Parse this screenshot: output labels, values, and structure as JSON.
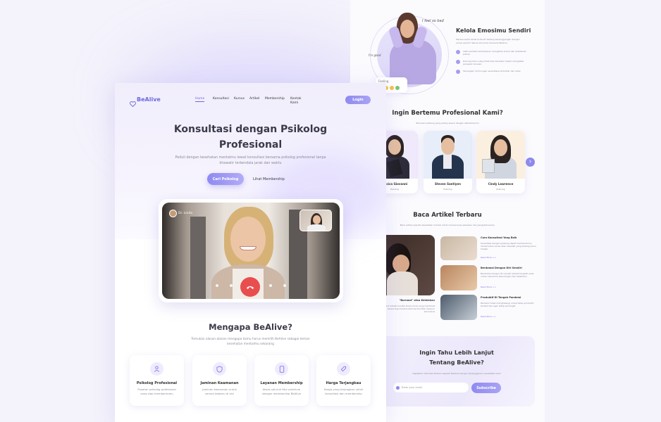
{
  "brand": {
    "name": "BeAlive"
  },
  "nav": {
    "items": [
      "Home",
      "Konsultasi",
      "Kursus",
      "Artikel",
      "Membership",
      "Kontak Kami"
    ],
    "login": "Login"
  },
  "hero": {
    "title_line1": "Konsultasi dengan Psikolog",
    "title_line2": "Profesional",
    "subtitle_line1": "Peduli dengan kesehatan mentalmu lewat konsultasi bersama psikolog profesional tanpa",
    "subtitle_line2": "khawatir terkendala jarak dan waktu",
    "cta_primary": "Cari Psikolog",
    "cta_secondary": "Lihat Membership",
    "call_name": "Dr. Linda"
  },
  "why": {
    "title": "Mengapa BeAlive?",
    "subtitle_line1": "Temukan alasan-alasan mengapa kamu harus memilih BeAlive sebagai teman",
    "subtitle_line2": "kesehatan mentalmu sekarang",
    "cards": [
      {
        "icon": "person-icon",
        "title": "Psikolog Profesional",
        "desc1": "Pusatan psikolog profesional",
        "desc2": "yang siap membantumu"
      },
      {
        "icon": "shield-icon",
        "title": "Jaminan Keamanan",
        "desc1": "Jaminan keamanan untuk",
        "desc2": "semua datamu di sini"
      },
      {
        "icon": "phone-icon",
        "title": "Layanan Membership",
        "desc1": "Akses seluruh fitur premium",
        "desc2": "dengan membership BeAlive"
      },
      {
        "icon": "tag-icon",
        "title": "Harga Terjangkau",
        "desc1": "Harga yang terjangkau untuk",
        "desc2": "konsultasi dan membership"
      }
    ]
  },
  "emotion": {
    "title": "Kelola Emosimu Sendiri",
    "desc": "Merasa sedih berlarut-larut? Sedang bersinggungan dengan emosi sendiri? Kelola emosimu bersama BeAlive",
    "bullets": [
      "Latih perilaku kemampuan mengelola emosi dan ketahanan pikiran",
      "Dukung kamu yang tidak bisa bersabar dalam mengatasi perasaan kecewa",
      "Tenangkan dirimu agar senantiasa terhindar dari stres"
    ],
    "doodle_top": "I feel so bad",
    "doodle_left": "I'm good",
    "mood_label": "Mood",
    "feeling_label": "Feeling"
  },
  "psych": {
    "title": "Ingin Bertemu Profesional Kami?",
    "subtitle": "Temukan psikolog yang paling sesuai dengan kebutuhanmu",
    "cards": [
      {
        "name": "Jessica Giovanni",
        "role": "Psikolog"
      },
      {
        "name": "Steven Santiyen",
        "role": "Psikolog"
      },
      {
        "name": "Cindy Lawrence",
        "role": "Psikolog"
      }
    ],
    "next": "›"
  },
  "articles": {
    "title": "Baca Artikel Terbaru",
    "subtitle": "Baca artikel seputar kesehatan mental untuk memperluas wawasan dan pengetahuanmu",
    "featured_title": "\"Burnout\" atau Kelelahan",
    "featured_desc": "Burnout adalah kondisi stres kronis yang membuat seseorang merasa lelah secara fisik maupun emosional",
    "items": [
      {
        "title": "Cara Konsultasi Yang Baik",
        "desc": "Konsultasi dengan psikolog dapat membantumu menemukan solusi atas masalah yang sedang kamu hadapi",
        "more": "Read More >>"
      },
      {
        "title": "Berdamai Dengan Diri Sendiri",
        "desc": "Berdamai dengan diri sendiri adalah langkah awal untuk menerima kekurangan dan kelebihan",
        "more": "Read More >>"
      },
      {
        "title": "Produktif Di Tengah Pandemi",
        "desc": "Pandemi tidak menghalangi untuk tetap produktif, berikut tips agar tetap semangat",
        "more": "Read More >>"
      }
    ]
  },
  "subscribe": {
    "title_line1": "Ingin Tahu Lebih Lanjut",
    "title_line2": "Tentang BeAlive?",
    "subtitle": "Dapatkan informasi terbaru seputar BeAlive dengan berlangganan newsletter kami",
    "placeholder": "Enter your email",
    "button": "Subscribe"
  },
  "colors": {
    "accent": "#7e79e6",
    "accent2": "#a8a2f3",
    "bg": "#f4f2fb",
    "text": "#3a3a4a",
    "end_call": "#e84e4e"
  }
}
